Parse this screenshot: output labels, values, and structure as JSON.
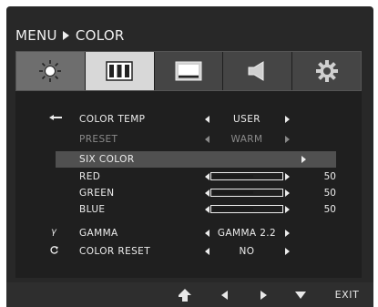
{
  "header": {
    "menu_label": "MENU",
    "section_label": "COLOR"
  },
  "tabs": [
    {
      "icon": "brightness-icon"
    },
    {
      "icon": "color-bars-icon",
      "active": true
    },
    {
      "icon": "display-icon"
    },
    {
      "icon": "speaker-icon"
    },
    {
      "icon": "gear-icon"
    }
  ],
  "settings": {
    "color_temp": {
      "label": "COLOR TEMP",
      "value": "USER"
    },
    "preset": {
      "label": "PRESET",
      "value": "WARM"
    },
    "six_color": {
      "label": "SIX COLOR"
    },
    "red": {
      "label": "RED",
      "value": "50"
    },
    "green": {
      "label": "GREEN",
      "value": "50"
    },
    "blue": {
      "label": "BLUE",
      "value": "50"
    },
    "gamma": {
      "label": "GAMMA",
      "value": "GAMMA 2.2"
    },
    "color_reset": {
      "label": "COLOR RESET",
      "value": "NO"
    }
  },
  "footer": {
    "exit_label": "EXIT"
  },
  "colors": {
    "background": "#282828",
    "active_tab": "#d8d8d8",
    "selected_row": "#505050",
    "text": "#ececec",
    "dimmed_text": "#8a8a8a"
  }
}
